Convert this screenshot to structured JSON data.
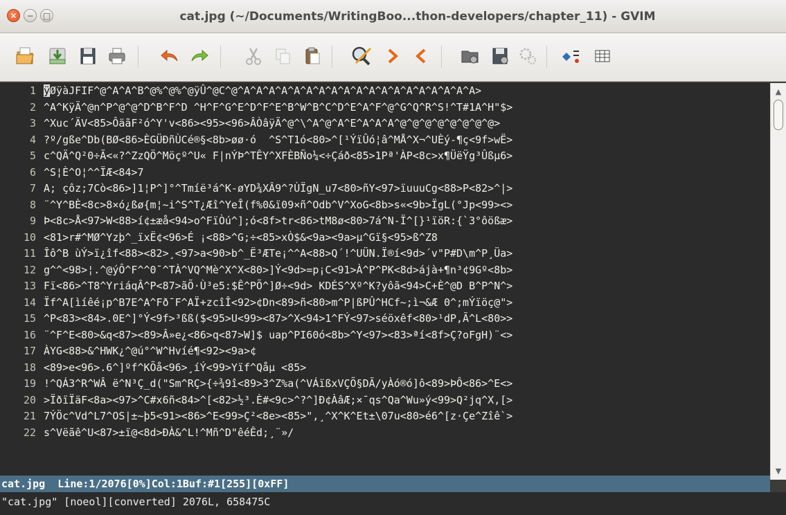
{
  "window": {
    "title": "cat.jpg (~/Documents/WritingBoo...thon-developers/chapter_11) - GVIM",
    "close_glyph": "✕",
    "minimize_glyph": "−",
    "maximize_glyph": "□"
  },
  "toolbar": {
    "buttons": [
      {
        "icon": "open-folder-icon"
      },
      {
        "icon": "save-download-icon"
      },
      {
        "icon": "save-disk-icon"
      },
      {
        "icon": "print-icon"
      },
      {
        "icon": "undo-icon"
      },
      {
        "icon": "redo-icon"
      },
      {
        "icon": "cut-icon"
      },
      {
        "icon": "copy-icon"
      },
      {
        "icon": "paste-icon"
      },
      {
        "icon": "find-replace-icon"
      },
      {
        "icon": "find-next-icon"
      },
      {
        "icon": "find-previous-icon"
      },
      {
        "icon": "load-session-icon"
      },
      {
        "icon": "save-session-icon"
      },
      {
        "icon": "run-script-icon"
      },
      {
        "icon": "make-icon"
      },
      {
        "icon": "table-icon"
      }
    ]
  },
  "editor": {
    "cursor_char": "ÿ",
    "lines": [
      {
        "num": "1",
        "text": "ØÿàJFIF^@^A^A^B^@%^@%^@ÿÛ^@C^@^A^A^A^A^A^A^A^A^A^A^A^A^A^A^A^A^A^A^A>"
      },
      {
        "num": "2",
        "text": "^A^KÿÄ^@n^P^@^@^D^B^F^D ^H^F^G^E^D^F^E^B^W^B^C^D^E^A^F^@^G^Q^R^S!^T#1A^H\"$>"
      },
      {
        "num": "3",
        "text": "^Xuc´ÄV<85>ÔäãF²ó^Y'v<86><95><96>ÂÒâÿÄ^@^\\^A^@^A^E^A^A^A^@^@^@^@^@^@^@^@>"
      },
      {
        "num": "4",
        "text": "?º/gße^Db(BØ<86>ÈGÜÐñÙCé®§<8b>øø·ó  ^S^T1ó<80>^[¹ÝïÛó¦â^MÅ^X¬^UÈý-¶ç<9f>wË>"
      },
      {
        "num": "5",
        "text": "c^QÄ^Q²0÷Ã<«?^ZzQÖ^Möçº^U« F|nÝÞ^TÊY^XFÈBÑo¼<÷Çáð<85>1Pª'ÀP<8c>x¶ÜëŸg³Ûßµ6>"
      },
      {
        "num": "6",
        "text": "^S¦È^O¦^^ÏÆ<84>7"
      },
      {
        "num": "7",
        "text": "A; çôz;7Cò<86>]1¦P^]°^Tmíë³á^K-øYD¾XÂ9^?ÙÏgN_u7<80>ñY<97>ïuuuCg<88>P<82>^|>"
      },
      {
        "num": "8",
        "text": "¨^Y^BÈ<8c>8×ó¿ßø{m¦~i^S^T¿Æî^YeÎ(f%0&ï09×ñ^Odb^V^XoG<8b>s«<9b>ÏgL(°Jp<99><>"
      },
      {
        "num": "9",
        "text": "Þ<8c>Å<97>W<88>í¢±æå<94>o^FïÒú^];ó<8f>tr<86>tM8ø<80>7á^N-Ï^[}¹ïöR:{`3°ôößæ>"
      },
      {
        "num": "10",
        "text": "<81>r#^MØ^Yzþ^_ïxË¢<96>É ¡<88>^G;÷<85>xÒ$&<9a><9a>µ^Gï§<95>ß^Z8"
      },
      {
        "num": "11",
        "text": "Îô^B ùÝ>ï¿îf<88><82>¸<97>a<90>b^_Ë³ÆTe¡^^A<88>Q´!^UÜN.Ï®í<9d>´v\"P#D\\m^P¸Üa>"
      },
      {
        "num": "12",
        "text": "g^^<98>¦.^@ýÔ^F^^0¯^TÀ^VQ^Mè^X^X<80>]Ý<9d>=p¡C<91>À^P^PK<8d>ájà+¶n³¢9Gº<8b>"
      },
      {
        "num": "13",
        "text": "Fï<86>^T8^YriáqÂ^P<87>ãÕ·Ù³e5:$Ê^PÕ^]Ø÷<9d> KDÉS^Xº^K?yôã<94>C+È^@D B^P^N^>"
      },
      {
        "num": "14",
        "text": "Ïf^A[ìíêé¡p^B7E^A^Fð¯F^AÏ+zcîÎ<92>¢Dn<89>ñ<80>m^P|ßPÛ^HCf~;ì¬&Æ 0^;mÝïöç@\">"
      },
      {
        "num": "15",
        "text": "^P<83><84>.0E^]°Ý<9f>³ßß($<95>U<99><87>^X<94>1^FÝ<97>séöxêf<80>¹dP,Ã^L<80>>"
      },
      {
        "num": "16",
        "text": "¨^F^E<80>&q<87><89>Â»e¿<86>q<87>W]$ uap^PI60ó<8b>^Y<97><83>ªí<8f>Ç?oFgH)¨<>"
      },
      {
        "num": "17",
        "text": "ÀYG<88>&^HWK¿^@ú°^W^Hvíé¶<92><9a>¢"
      },
      {
        "num": "18",
        "text": "<89>e<96>.6^]ºf^KÕå<96>¸íÝ<99>Yïf^Qåµ <85>"
      },
      {
        "num": "19",
        "text": "!^QÁ3^R^WÂ ë^N³Ç_d(\"Sm^RÇ>{÷¾9î<89>3^Z%a(^VÁïßxVÇÕ§DÃ/yÀó®ó]ô<89>ÞÔ<86>^E<>"
      },
      {
        "num": "20",
        "text": ">ÏðïÏäF<8a><97>^C#x6ñ<84>^[<82>½³.È#<9c>^?^]Ð¢ÀâÆ;×¯qs^Qa^Wu»ý<99>Q²jq^X,[>"
      },
      {
        "num": "21",
        "text": "7ÝÖc^Vd^L7^OS|±~þ5<91><86>^E<99>Ç²<8e><85>\",¸^X^K^Et±\\07u<80>é6^[z·Çe^Zîê`>"
      },
      {
        "num": "22",
        "text": "s^Vëãê^U<87>±ï@<8d>ÐÀ&^L!^Mñ^D\"êéÊd;¸¨»/"
      }
    ]
  },
  "statusline": "cat.jpg  Line:1/2076[0%]Col:1Buf:#1[255][0xFF]",
  "cmdline": "\"cat.jpg\" [noeol][converted] 2076L, 658475C"
}
